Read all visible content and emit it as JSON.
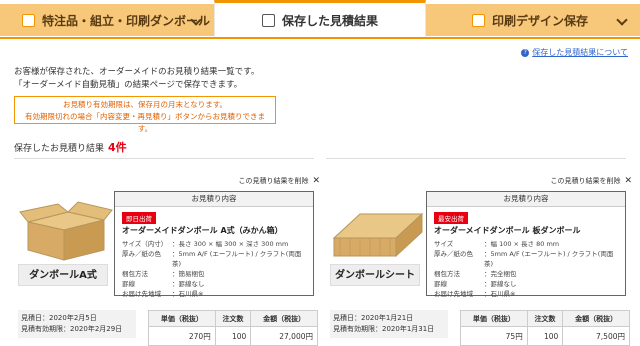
{
  "tabs": [
    {
      "label": "特注品・組立・印刷ダンボール",
      "icon": "box-icon",
      "active": false
    },
    {
      "label": "保存した見積結果",
      "icon": "document-icon",
      "active": true
    },
    {
      "label": "印刷デザイン保存",
      "icon": "image-icon",
      "active": false
    }
  ],
  "help_link": "保存した見積結果について",
  "intro": {
    "line1": "お客様が保存された、オーダーメイドのお見積り結果一覧です。",
    "line2": "「オーダーメイド自動見積」の結果ページで保存できます。"
  },
  "notice": {
    "line1": "お見積り有効期限は、保存月の月末となります。",
    "line2": "有効期限切れの場合「内容変更・再見積り」ボタンからお見積りできます。"
  },
  "saved": {
    "label": "保存したお見積り結果",
    "count": "4件"
  },
  "colors": {
    "accent": "#f29500",
    "tab_bg": "#f7c87a",
    "badge": "#e60012",
    "count": "#e60012"
  },
  "cards": [
    {
      "delete_label": "この見積り結果を削除",
      "box_header": "お見積り内容",
      "badge": "即日出荷",
      "product_name": "オーダーメイドダンボール A式（みかん箱）",
      "product_label": "ダンボールA式",
      "specs": [
        {
          "k": "サイズ（内寸）",
          "v": "：長さ 300 × 幅 300 × 深さ 300 mm"
        },
        {
          "k": "厚み／紙の色",
          "v": "：5mm A/F (エーフルート) / クラフト(両面茶)"
        },
        {
          "k": "梱包方法",
          "v": "：簡易梱包"
        },
        {
          "k": "罫線",
          "v": "：罫線なし"
        },
        {
          "k": "お届け先地域",
          "v": "：石川県※"
        }
      ],
      "dates": {
        "quote_date": "見積日：2020年2月5日",
        "valid_until": "見積有効期限：2020年2月29日"
      },
      "price": {
        "headers": [
          "単価（税抜）",
          "注文数",
          "金額（税抜）"
        ],
        "unit": "270円",
        "qty": "100",
        "total": "27,000円"
      }
    },
    {
      "delete_label": "この見積り結果を削除",
      "box_header": "お見積り内容",
      "badge": "最安出荷",
      "product_name": "オーダーメイドダンボール 板ダンボール",
      "product_label": "ダンボールシート",
      "specs": [
        {
          "k": "サイズ",
          "v": "：幅 100 × 長さ 80 mm"
        },
        {
          "k": "厚み／紙の色",
          "v": "：5mm A/F (エーフルート) / クラフト(両面茶)"
        },
        {
          "k": "梱包方法",
          "v": "：完全梱包"
        },
        {
          "k": "罫線",
          "v": "：罫線なし"
        },
        {
          "k": "お届け先地域",
          "v": "：石川県※"
        }
      ],
      "dates": {
        "quote_date": "見積日：2020年1月21日",
        "valid_until": "見積有効期限：2020年1月31日"
      },
      "price": {
        "headers": [
          "単価（税抜）",
          "注文数",
          "金額（税抜）"
        ],
        "unit": "75円",
        "qty": "100",
        "total": "7,500円"
      }
    }
  ]
}
